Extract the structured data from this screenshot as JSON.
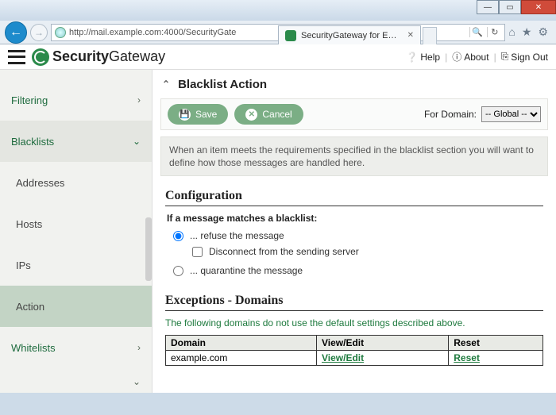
{
  "window": {
    "min": "—",
    "max": "▭",
    "close": "✕"
  },
  "browser": {
    "url": "http://mail.example.com:4000/SecurityGate",
    "tab_title": "SecurityGateway for Email S...",
    "tab_close": "✕"
  },
  "header": {
    "brand_bold": "Security",
    "brand_light": "Gateway",
    "help": "Help",
    "about": "About",
    "signout": "Sign Out"
  },
  "sidebar": {
    "truncated_top": "",
    "filtering": "Filtering",
    "blacklists": "Blacklists",
    "addresses": "Addresses",
    "hosts": "Hosts",
    "ips": "IPs",
    "action": "Action",
    "whitelists": "Whitelists"
  },
  "main": {
    "title": "Blacklist Action",
    "save": "Save",
    "cancel": "Cancel",
    "for_domain_label": "For Domain:",
    "for_domain_value": "-- Global --",
    "description": "When an item meets the requirements specified in the blacklist section you will want to define how those messages are handled here.",
    "config_heading": "Configuration",
    "config_lead": "If a message matches a blacklist:",
    "opt_refuse": "... refuse the message",
    "opt_disconnect": "Disconnect from the sending server",
    "opt_quarantine": "... quarantine the message",
    "exceptions_heading": "Exceptions - Domains",
    "exceptions_intro": "The following domains do not use the default settings described above.",
    "table": {
      "col_domain": "Domain",
      "col_viewedit": "View/Edit",
      "col_reset": "Reset",
      "rows": [
        {
          "domain": "example.com",
          "viewedit": "View/Edit",
          "reset": "Reset"
        }
      ]
    }
  }
}
